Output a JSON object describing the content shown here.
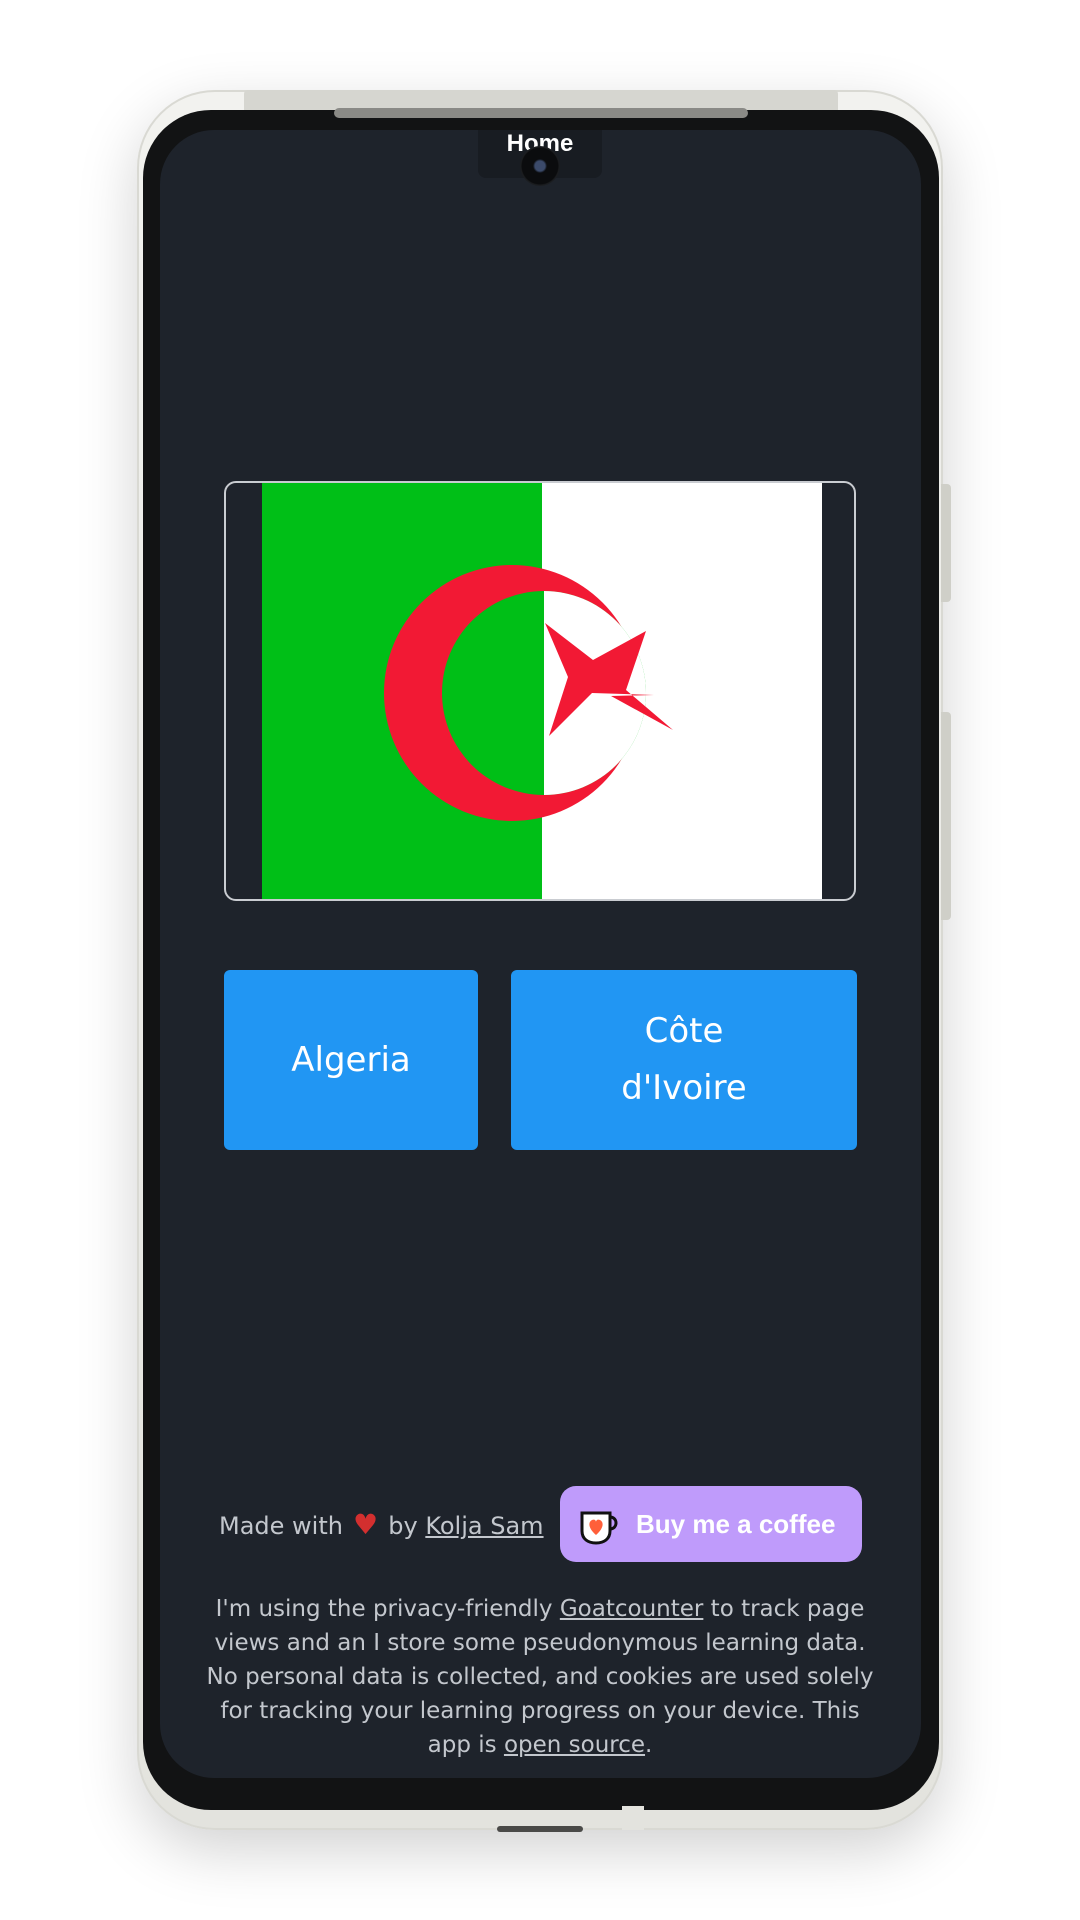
{
  "header": {
    "title": "Home"
  },
  "quiz": {
    "flag_icon": "algeria-flag",
    "colors": {
      "flag_green": "#00bf17",
      "flag_white": "#ffffff",
      "flag_red": "#f21934"
    },
    "options": [
      {
        "label": "Algeria"
      },
      {
        "label": "Côte d'Ivoire"
      }
    ],
    "button_color": "#2196f3"
  },
  "footer": {
    "made_with": "Made with",
    "heart_icon": "heart-icon",
    "by": "by",
    "author": "Kolja Sam",
    "coffee_button": "Buy me a coffee",
    "coffee_color": "#bf9bfb",
    "privacy": {
      "part1": "I'm using the privacy-friendly ",
      "goatcounter": "Goatcounter",
      "part2": " to track page views and an I store some pseudonymous learning data. No personal data is collected, and cookies are used solely for tracking your learning progress on your device. This app is ",
      "open_source": "open source",
      "part3": "."
    }
  },
  "theme": {
    "background": "#1e232b"
  }
}
